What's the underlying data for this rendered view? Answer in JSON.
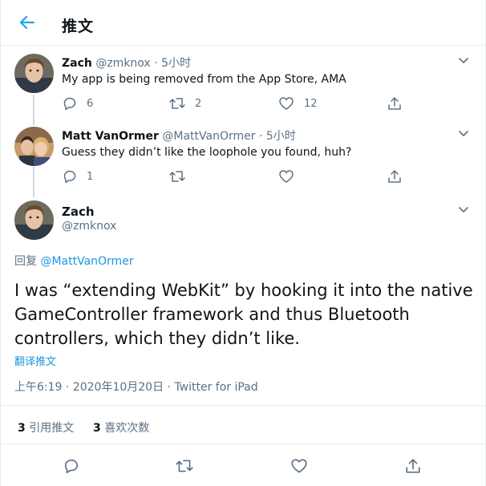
{
  "header": {
    "title": "推文"
  },
  "tweet1": {
    "name": "Zach",
    "handle": "@zmknox",
    "dot": "·",
    "time": "5小时",
    "text": "My app is being removed from the App Store, AMA",
    "replies": "6",
    "retweets": "2",
    "likes": "12"
  },
  "tweet2": {
    "name": "Matt VanOrmer",
    "handle": "@MattVanOrmer",
    "dot": "·",
    "time": "5小时",
    "text": "Guess they didn’t like the loophole you found, huh?",
    "replies": "1"
  },
  "main": {
    "name": "Zach",
    "handle": "@zmknox",
    "reply_prefix": "回复",
    "reply_to": "@MattVanOrmer",
    "text_line1": "I was “extending WebKit” by hooking it into the native",
    "text_line2": "GameController framework and thus Bluetooth",
    "text_line3": "controllers, which they didn’t like.",
    "translate": "翻译推文",
    "time": "上午6:19",
    "dot1": "·",
    "date": "2020年10月20日",
    "dot2": "·",
    "source": "Twitter for iPad",
    "retweet_count": "3",
    "retweet_label": "引用推文",
    "like_count": "3",
    "like_label": "喜欢次数"
  },
  "colors": {
    "accent": "#1da1f2",
    "link": "#1b95e0",
    "muted": "#5b7083",
    "border": "#e6ecf0"
  },
  "icons": [
    "back-arrow-icon",
    "chevron-down-icon",
    "reply-icon",
    "retweet-icon",
    "like-icon",
    "share-icon"
  ]
}
